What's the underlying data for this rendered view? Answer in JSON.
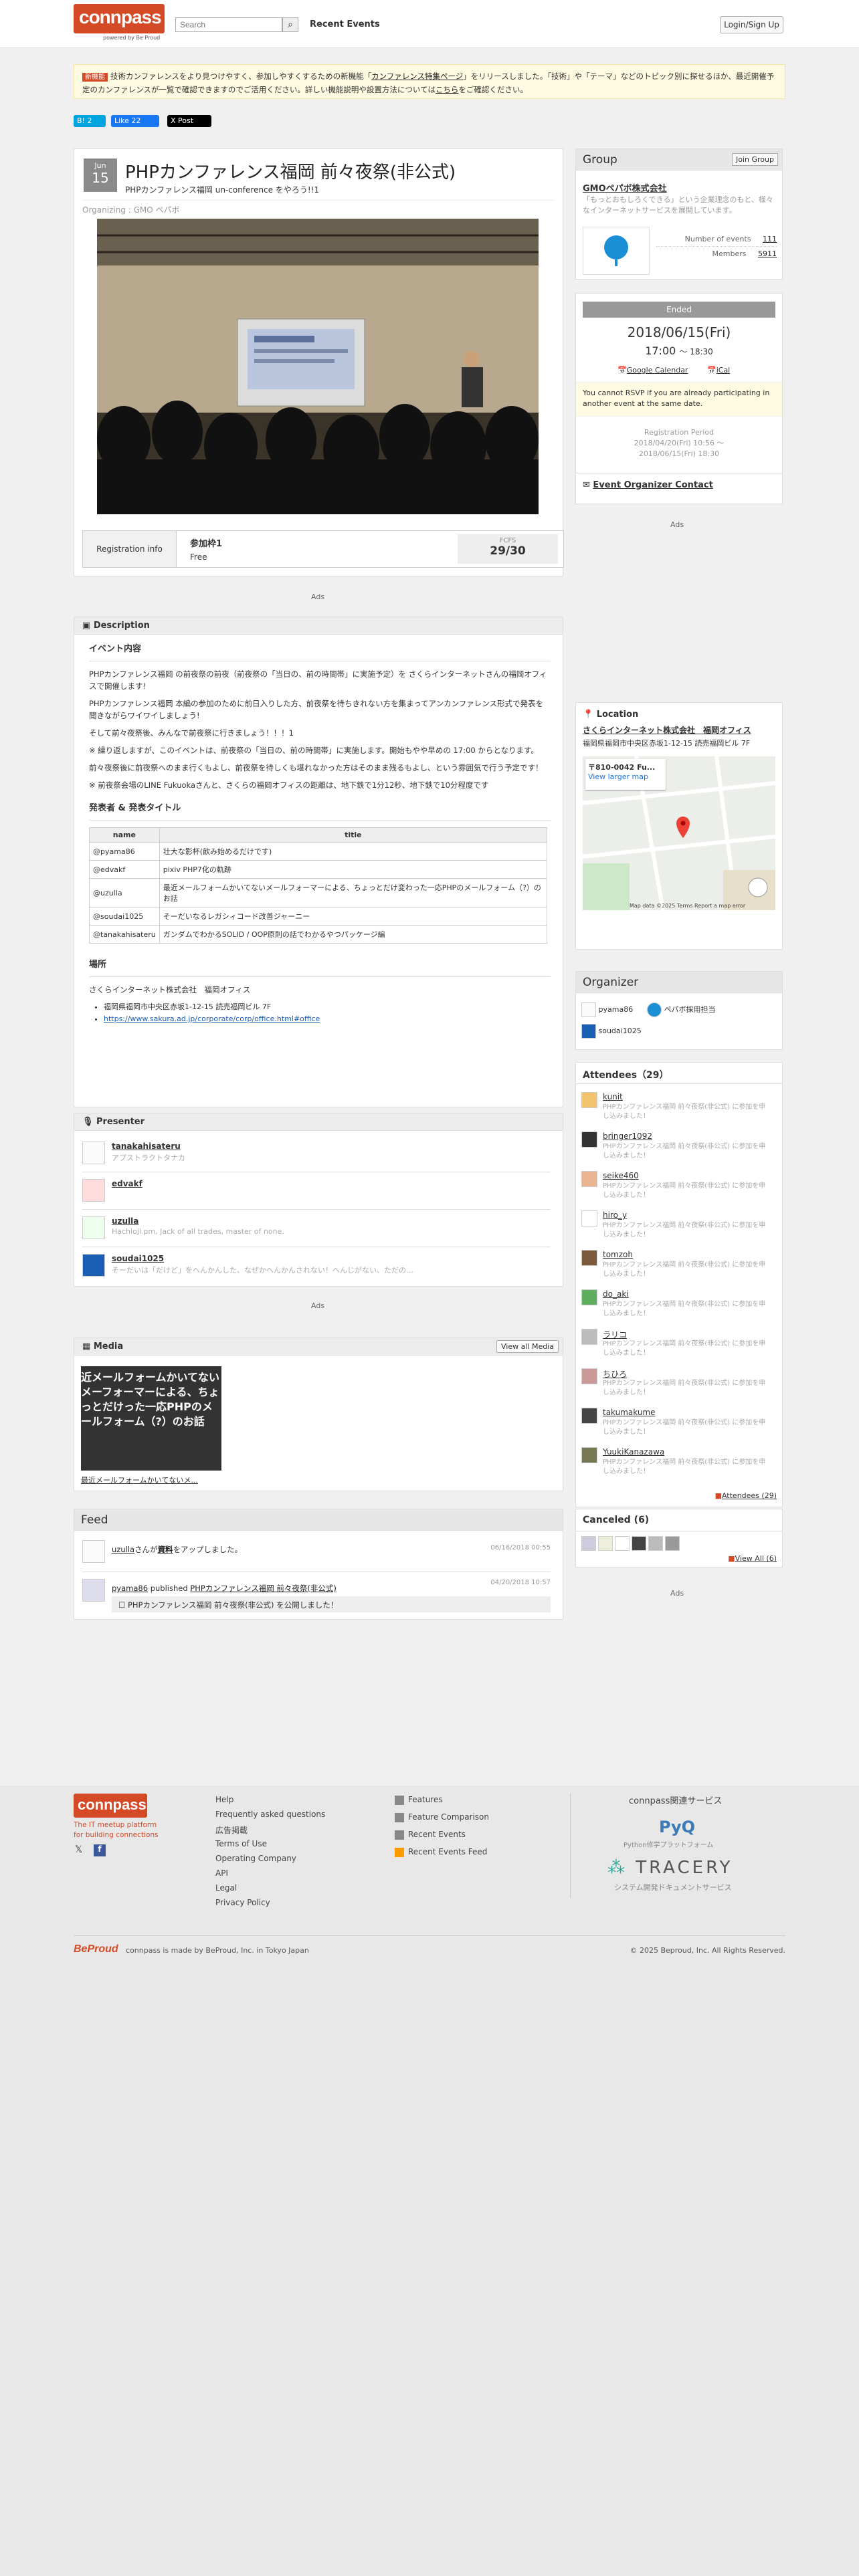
{
  "header": {
    "logo": "connpass",
    "logo_sub": "powered by Be Proud",
    "search_placeholder": "Search",
    "recent_events": "Recent Events",
    "login": "Login/Sign Up"
  },
  "notice": {
    "badge": "新機能",
    "text_1": "技術カンファレンスをより見つけやすく、参加しやすくするための新機能「",
    "link": "カンファレンス特集ページ",
    "text_2": "」をリリースしました。「技術」や「テーマ」などのトピック別に探せるほか、最近開催予定のカンファレンスが一覧で確認できますのでご活用ください。詳しい機能説明や設置方法については",
    "link2": "こちら",
    "text_3": "をご確認ください。"
  },
  "social": {
    "hatena": "B! 2",
    "facebook": "Like 22",
    "x": "X Post"
  },
  "event": {
    "month": "Jun",
    "day": "15",
    "title": "PHPカンファレンス福岡 前々夜祭(非公式)",
    "subtitle": "PHPカンファレンス福岡 un-conference をやろう!!1",
    "organizing": "Organizing : GMO ペパボ",
    "reg_label": "Registration info",
    "reg_name": "参加枠1",
    "reg_price": "Free",
    "reg_type": "FCFS",
    "reg_count": "29/30",
    "ads": "Ads"
  },
  "description": {
    "title": "Description",
    "h_event": "イベント内容",
    "p1": "PHPカンファレンス福岡 の前夜祭の前夜（前夜祭の「当日の、前の時間帯」に実施予定）を さくらインターネットさんの福岡オフィスで開催します!",
    "p2": "PHPカンファレンス福岡 本編の参加のために前日入りした方、前夜祭を待ちきれない方を集まってアンカンファレンス形式で発表を聞きながらワイワイしましょう!",
    "p3": "そして前々夜祭後、みんなで前夜祭に行きましょう！！！1",
    "p4": "※ 繰り返しますが、このイベントは、前夜祭の「当日の、前の時間帯」に実施します。開始もやや早めの 17:00 からとなります。",
    "p5": "前々夜祭後に前夜祭へのまま行くもよし、前夜祭を待しくも堪れなかった方はそのまま残るもよし、という雰囲気で行う予定です！",
    "p6": "※ 前夜祭会場のLINE Fukuokaさんと、さくらの福岡オフィスの距離は、地下鉄で1分12秒、地下鉄で10分程度です",
    "h_speakers": "発表者 & 発表タイトル",
    "col_name": "name",
    "col_title": "title",
    "rows": [
      {
        "name": "@pyama86",
        "title": "壮大な影杯(飲み始めるだけです)"
      },
      {
        "name": "@edvakf",
        "title": "pixiv PHP7化の軌跡"
      },
      {
        "name": "@uzulla",
        "title": "最近メールフォームかいてないメールフォーマーによる、ちょっとだけ変わった一応PHPのメールフォーム（?）のお話"
      },
      {
        "name": "@soudai1025",
        "title": "そーだいなるレガシィコード改善ジャーニー"
      },
      {
        "name": "@tanakahisateru",
        "title": "ガンダムでわかるSOLID / OOP原則の話でわかるやつパッケージ編"
      }
    ],
    "h_place": "場所",
    "place": "さくらインターネット株式会社　福岡オフィス",
    "place_addr": "福岡県福岡市中央区赤坂1-12-15 読売福岡ビル 7F",
    "place_url": "https://www.sakura.ad.jp/corporate/corp/office.html#office"
  },
  "presenter": {
    "title": "Presenter",
    "items": [
      {
        "name": "tanakahisateru",
        "desc": "アプストラクトタナカ"
      },
      {
        "name": "edvakf",
        "desc": ""
      },
      {
        "name": "uzulla",
        "desc": "Hachioji.pm, Jack of all trades, master of none."
      },
      {
        "name": "soudai1025",
        "desc": "そーだいは「だけど」をへんかんした、なぜかへんかんされない！へんじがない、ただの…"
      }
    ]
  },
  "media": {
    "title": "Media",
    "view_all": "View all Media",
    "thumb_text": "近メールフォームかいてないメーフォーマーによる、ちょっとだけった一応PHPのメールフォーム（?）のお話",
    "caption": "最近メールフォームかいてないメ..."
  },
  "feed": {
    "title": "Feed",
    "items": [
      {
        "user": "uzulla",
        "text": "さんが",
        "link": "資料",
        "text2": "をアップしました。",
        "time": "06/16/2018 00:55"
      },
      {
        "user": "pyama86",
        "text": "published",
        "link": "PHPカンファレンス福岡 前々夜祭(非公式)",
        "time": "04/20/2018 10:57",
        "sub": "PHPカンファレンス福岡 前々夜祭(非公式) を公開しました！"
      }
    ]
  },
  "group": {
    "title": "Group",
    "join": "Join Group",
    "name": "GMOペパボ株式会社",
    "desc": "「もっとおもしろくできる」という企業理念のもと、様々なインターネットサービスを展開しています。",
    "events_label": "Number of events",
    "events_value": "111",
    "members_label": "Members",
    "members_value": "5911"
  },
  "status": {
    "badge": "Ended",
    "date": "2018/06/15(Fri)",
    "time": "17:00",
    "time_end": "～ 18:30",
    "gcal": "Google Calendar",
    "ical": "iCal",
    "warning": "You cannot RSVP if you are already participating in another event at the same date.",
    "period_label": "Registration Period",
    "period_1": "2018/04/20(Fri) 10:56 ～",
    "period_2": "2018/06/15(Fri) 18:30",
    "contact": "Event Organizer Contact"
  },
  "location": {
    "title": "Location",
    "name": "さくらインターネット株式会社　福岡オフィス",
    "addr": "福岡県福岡市中央区赤坂1-12-15 読売福岡ビル 7F",
    "map_pin": "〒810-0042 Fu...",
    "larger": "View larger map",
    "map_footer": "Map data ©2025   Terms   Report a map error"
  },
  "organizer": {
    "title": "Organizer",
    "items": [
      "pyama86",
      "ペパボ採用担当",
      "soudai1025"
    ]
  },
  "attendees": {
    "title": "Attendees（29）",
    "desc": "PHPカンファレンス福岡 前々夜祭(非公式) に参加を申し込みました！",
    "items": [
      "kunit",
      "bringer1092",
      "seike460",
      "hiro_y",
      "tomzoh",
      "do_aki",
      "ラリコ",
      "ちひろ",
      "takumakume",
      "YuukiKanazawa"
    ],
    "more": "Attendees (29)"
  },
  "canceled": {
    "title": "Canceled (6)",
    "more": "View All (6)"
  },
  "footer": {
    "logo": "connpass",
    "tagline": "The IT meetup platform for building connections",
    "col1": [
      "Help",
      "Frequently asked questions",
      "広告掲載",
      "Terms of Use",
      "Operating Company",
      "API",
      "Legal",
      "Privacy Policy"
    ],
    "col2": [
      "Features",
      "Feature Comparison",
      "Recent Events",
      "Recent Events Feed"
    ],
    "related": "connpass関連サービス",
    "pyq_sub": "Python修学プラットフォーム",
    "tracery": "TRACERY",
    "tracery_sub": "システム開発ドキュメントサービス",
    "made_by": "connpass is made by BeProud, Inc. in Tokyo Japan",
    "copyright": "© 2025 Beproud, Inc. All Rights Reserved."
  }
}
